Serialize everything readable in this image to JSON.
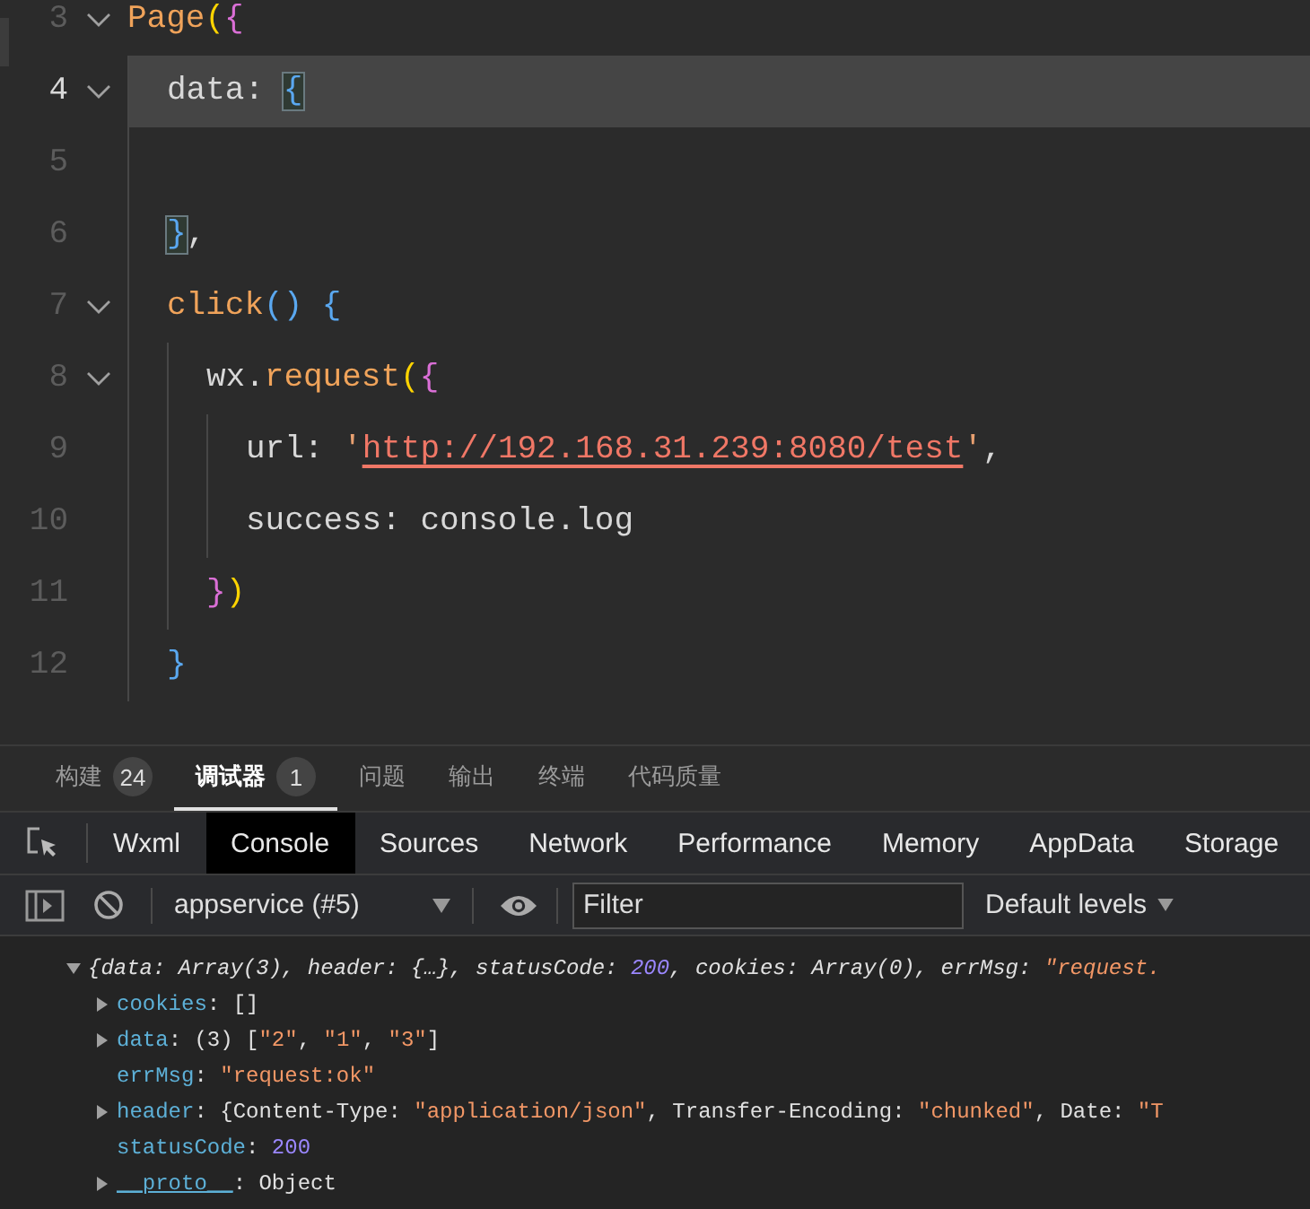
{
  "editor": {
    "lines": [
      {
        "number": "3",
        "fold": true,
        "current": false,
        "tokens": [
          {
            "kind": "fn",
            "text": "Page"
          },
          {
            "kind": "b1",
            "text": "("
          },
          {
            "kind": "b2",
            "text": "{"
          }
        ],
        "children": [
          {
            "number": "4",
            "fold": true,
            "current": true,
            "tokens": [
              {
                "kind": "text",
                "text": "data: "
              },
              {
                "kind": "match",
                "text": "{"
              }
            ]
          },
          {
            "number": "5",
            "fold": false,
            "current": false
          },
          {
            "number": "6",
            "fold": false,
            "current": false,
            "tokens": [
              {
                "kind": "match",
                "text": "}"
              },
              {
                "kind": "text",
                "text": ","
              }
            ]
          },
          {
            "number": "7",
            "fold": true,
            "current": false,
            "tokens": [
              {
                "kind": "fn",
                "text": "click"
              },
              {
                "kind": "b3",
                "text": "() {"
              }
            ],
            "children": [
              {
                "number": "8",
                "fold": true,
                "current": false,
                "tokens": [
                  {
                    "kind": "text",
                    "text": "wx."
                  },
                  {
                    "kind": "fn",
                    "text": "request"
                  },
                  {
                    "kind": "b1",
                    "text": "("
                  },
                  {
                    "kind": "b2",
                    "text": "{"
                  }
                ],
                "children": [
                  {
                    "number": "9",
                    "fold": false,
                    "current": false,
                    "tokens": [
                      {
                        "kind": "text",
                        "text": "url: "
                      },
                      {
                        "kind": "quote",
                        "text": "'"
                      },
                      {
                        "kind": "url",
                        "text": "http://192.168.31.239:8080/test"
                      },
                      {
                        "kind": "quote",
                        "text": "'"
                      },
                      {
                        "kind": "text",
                        "text": ","
                      }
                    ]
                  },
                  {
                    "number": "10",
                    "fold": false,
                    "current": false,
                    "tokens": [
                      {
                        "kind": "text",
                        "text": "success: console.log"
                      }
                    ]
                  }
                ]
              },
              {
                "number": "11",
                "fold": false,
                "current": false,
                "tokens": [
                  {
                    "kind": "b2",
                    "text": "}"
                  },
                  {
                    "kind": "b1",
                    "text": ")"
                  }
                ]
              }
            ]
          },
          {
            "number": "12",
            "fold": false,
            "current": false,
            "tokens": [
              {
                "kind": "b3",
                "text": "}"
              }
            ]
          }
        ]
      }
    ]
  },
  "panel_tabs": [
    {
      "label": "构建",
      "badge": "24",
      "selected": false
    },
    {
      "label": "调试器",
      "badge": "1",
      "selected": true
    },
    {
      "label": "问题",
      "selected": false
    },
    {
      "label": "输出",
      "selected": false
    },
    {
      "label": "终端",
      "selected": false
    },
    {
      "label": "代码质量",
      "selected": false
    }
  ],
  "devtools_tabs": [
    {
      "label": "Wxml",
      "selected": false
    },
    {
      "label": "Console",
      "selected": true
    },
    {
      "label": "Sources",
      "selected": false
    },
    {
      "label": "Network",
      "selected": false
    },
    {
      "label": "Performance",
      "selected": false
    },
    {
      "label": "Memory",
      "selected": false
    },
    {
      "label": "AppData",
      "selected": false
    },
    {
      "label": "Storage",
      "selected": false
    }
  ],
  "console_toolbar": {
    "context": "appservice (#5)",
    "filter": {
      "placeholder": "Filter"
    },
    "levels": "Default levels"
  },
  "console": {
    "summary": {
      "expanded": true,
      "tokens": [
        {
          "kind": "plain",
          "text": "{data: Array(3), header: {…}, statusCode: "
        },
        {
          "kind": "number",
          "text": "200"
        },
        {
          "kind": "plain",
          "text": ", cookies: Array(0), errMsg: "
        },
        {
          "kind": "string",
          "text": "\"request."
        }
      ]
    },
    "properties": [
      {
        "expandable": true,
        "tokens": [
          {
            "kind": "key",
            "text": "cookies"
          },
          {
            "kind": "plain",
            "text": ": []"
          }
        ]
      },
      {
        "expandable": true,
        "tokens": [
          {
            "kind": "key",
            "text": "data"
          },
          {
            "kind": "plain",
            "text": ": (3) ["
          },
          {
            "kind": "string",
            "text": "\"2\""
          },
          {
            "kind": "plain",
            "text": ", "
          },
          {
            "kind": "string",
            "text": "\"1\""
          },
          {
            "kind": "plain",
            "text": ", "
          },
          {
            "kind": "string",
            "text": "\"3\""
          },
          {
            "kind": "plain",
            "text": "]"
          }
        ]
      },
      {
        "expandable": false,
        "tokens": [
          {
            "kind": "key",
            "text": "errMsg"
          },
          {
            "kind": "plain",
            "text": ": "
          },
          {
            "kind": "string",
            "text": "\"request:ok\""
          }
        ]
      },
      {
        "expandable": true,
        "tokens": [
          {
            "kind": "key",
            "text": "header"
          },
          {
            "kind": "plain",
            "text": ": {Content-Type: "
          },
          {
            "kind": "string",
            "text": "\"application/json\""
          },
          {
            "kind": "plain",
            "text": ", Transfer-Encoding: "
          },
          {
            "kind": "string",
            "text": "\"chunked\""
          },
          {
            "kind": "plain",
            "text": ", Date: "
          },
          {
            "kind": "string",
            "text": "\"T"
          }
        ]
      },
      {
        "expandable": false,
        "tokens": [
          {
            "kind": "key",
            "text": "statusCode"
          },
          {
            "kind": "plain",
            "text": ": "
          },
          {
            "kind": "number",
            "text": "200"
          }
        ]
      },
      {
        "expandable": true,
        "tokens": [
          {
            "kind": "proto",
            "text": "__proto__"
          },
          {
            "kind": "plain",
            "text": ": Object"
          }
        ]
      }
    ]
  }
}
